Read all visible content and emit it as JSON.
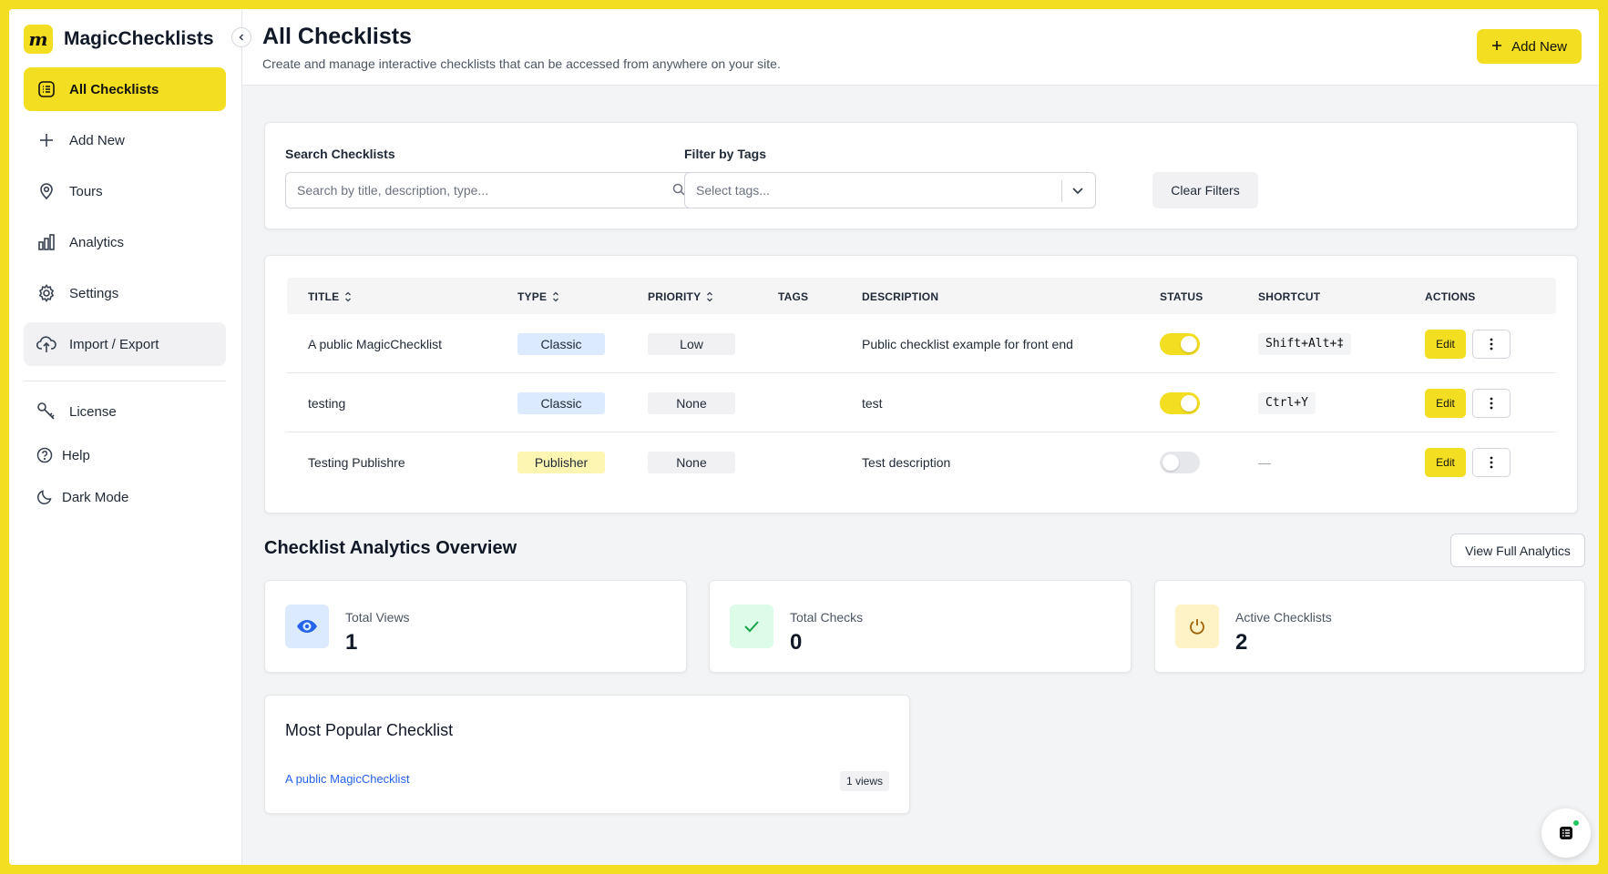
{
  "app": {
    "name": "MagicChecklists",
    "logo_letter": "m",
    "accent_color": "#f3de22"
  },
  "sidebar": {
    "items": [
      {
        "label": "All Checklists",
        "icon": "list-icon",
        "active": true
      },
      {
        "label": "Add New",
        "icon": "plus-icon"
      },
      {
        "label": "Tours",
        "icon": "map-pin-icon"
      },
      {
        "label": "Analytics",
        "icon": "bar-chart-icon"
      },
      {
        "label": "Settings",
        "icon": "gear-icon"
      },
      {
        "label": "Import / Export",
        "icon": "cloud-upload-icon",
        "hover": true
      }
    ],
    "secondary": [
      {
        "label": "License",
        "icon": "key-icon"
      },
      {
        "label": "Help",
        "icon": "help-circle-icon"
      },
      {
        "label": "Dark Mode",
        "icon": "moon-icon"
      }
    ]
  },
  "header": {
    "title": "All Checklists",
    "subtitle": "Create and manage interactive checklists that can be accessed from anywhere on your site.",
    "add_new_label": "Add New"
  },
  "filters": {
    "search_label": "Search Checklists",
    "search_placeholder": "Search by title, description, type...",
    "tags_label": "Filter by Tags",
    "tags_placeholder": "Select tags...",
    "clear_label": "Clear Filters"
  },
  "table": {
    "columns": [
      "TITLE",
      "TYPE",
      "PRIORITY",
      "TAGS",
      "DESCRIPTION",
      "STATUS",
      "SHORTCUT",
      "ACTIONS"
    ],
    "rows": [
      {
        "title": "A public MagicChecklist",
        "type": "Classic",
        "priority": "Low",
        "tags": "",
        "description": "Public checklist example for front end",
        "status": "on",
        "shortcut": "Shift+Alt+‡",
        "action": "Edit"
      },
      {
        "title": "testing",
        "type": "Classic",
        "priority": "None",
        "tags": "",
        "description": "test",
        "status": "on",
        "shortcut": "Ctrl+Y",
        "action": "Edit"
      },
      {
        "title": "Testing Publishre",
        "type": "Publisher",
        "priority": "None",
        "tags": "",
        "description": "Test description",
        "status": "off",
        "shortcut": "—",
        "action": "Edit"
      }
    ]
  },
  "analytics": {
    "title": "Checklist Analytics Overview",
    "view_full_label": "View Full Analytics",
    "stats": [
      {
        "label": "Total Views",
        "value": "1",
        "icon": "eye-icon",
        "color": "#2563eb",
        "bg": "#dbeafe"
      },
      {
        "label": "Total Checks",
        "value": "0",
        "icon": "check-icon",
        "color": "#16a34a",
        "bg": "#dcfce7"
      },
      {
        "label": "Active Checklists",
        "value": "2",
        "icon": "power-icon",
        "color": "#a16207",
        "bg": "#fef3c7"
      }
    ],
    "popular": {
      "title": "Most Popular Checklist",
      "item": "A public MagicChecklist",
      "views": "1 views"
    }
  }
}
